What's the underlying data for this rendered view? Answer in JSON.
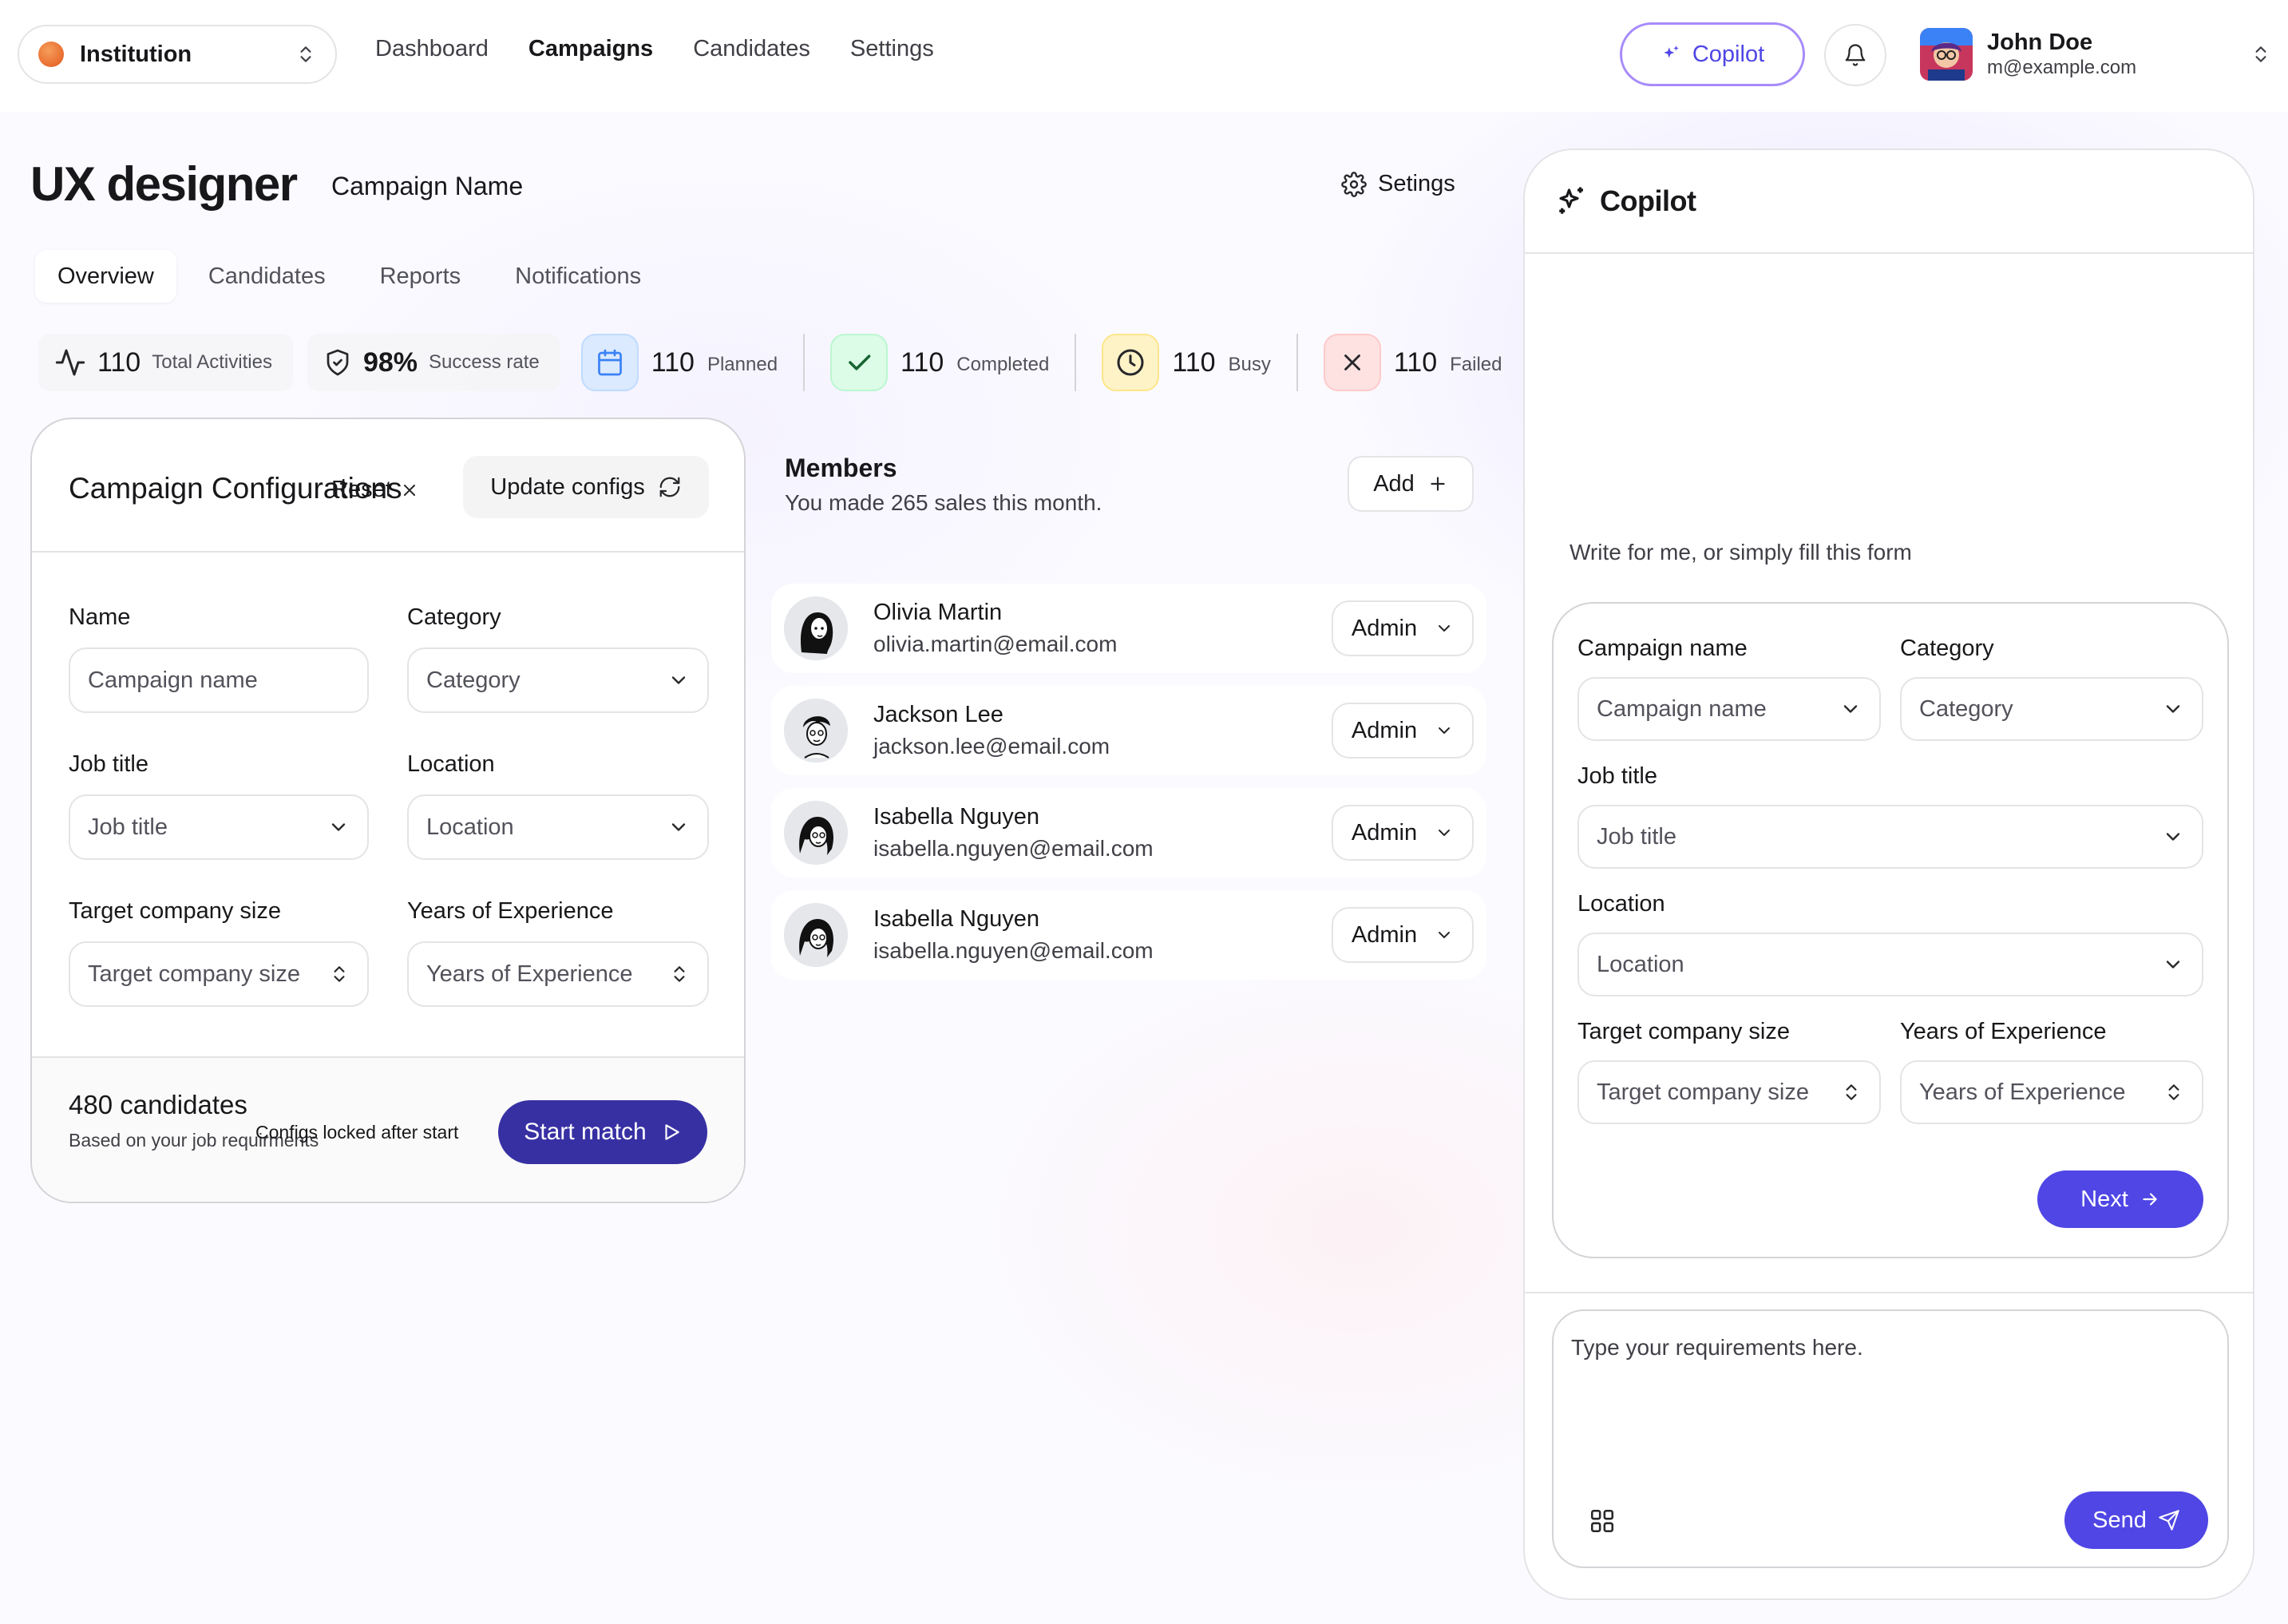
{
  "topbar": {
    "institution": "Institution",
    "nav": [
      "Dashboard",
      "Campaigns",
      "Candidates",
      "Settings"
    ],
    "active_nav": "Campaigns",
    "copilot_label": "Copilot",
    "user": {
      "name": "John Doe",
      "email": "m@example.com"
    }
  },
  "header": {
    "title": "UX designer",
    "campaign_name": "Campaign Name",
    "settings_label": "Setings"
  },
  "tabs": [
    "Overview",
    "Candidates",
    "Reports",
    "Notifications"
  ],
  "active_tab": "Overview",
  "stats": {
    "total": {
      "value": "110",
      "label": "Total Activities"
    },
    "success": {
      "value": "98%",
      "label": "Success rate"
    },
    "planned": {
      "value": "110",
      "label": "Planned",
      "color": "#dbeafe"
    },
    "completed": {
      "value": "110",
      "label": "Completed",
      "color": "#dcfce7"
    },
    "busy": {
      "value": "110",
      "label": "Busy",
      "color": "#fef3c7"
    },
    "failed": {
      "value": "110",
      "label": "Failed",
      "color": "#fee2e2"
    }
  },
  "config": {
    "title": "Campaign Configurations",
    "reset_label": "Reset",
    "update_label": "Update configs",
    "fields": {
      "name": {
        "label": "Name",
        "placeholder": "Campaign name"
      },
      "category": {
        "label": "Category",
        "placeholder": "Category"
      },
      "job_title": {
        "label": "Job title",
        "placeholder": "Job title"
      },
      "location": {
        "label": "Location",
        "placeholder": "Location"
      },
      "company_size": {
        "label": "Target company size",
        "placeholder": "Target company size"
      },
      "experience": {
        "label": "Years of Experience",
        "placeholder": "Years of Experience"
      }
    },
    "candidates": "480 candidates",
    "candidates_sub": "Based on your job requirments",
    "locked": "Configs locked after start",
    "start_label": "Start match"
  },
  "members": {
    "title": "Members",
    "subtitle": "You made 265 sales this month.",
    "add_label": "Add",
    "list": [
      {
        "name": "Olivia Martin",
        "email": "olivia.martin@email.com",
        "role": "Admin"
      },
      {
        "name": "Jackson Lee",
        "email": "jackson.lee@email.com",
        "role": "Admin"
      },
      {
        "name": "Isabella Nguyen",
        "email": "isabella.nguyen@email.com",
        "role": "Admin"
      },
      {
        "name": "Isabella Nguyen",
        "email": "isabella.nguyen@email.com",
        "role": "Admin"
      }
    ]
  },
  "copilot": {
    "title": "Copilot",
    "prompt": "Write for me, or simply fill this form",
    "fields": {
      "campaign_name": {
        "label": "Campaign name",
        "placeholder": "Campaign name"
      },
      "category": {
        "label": "Category",
        "placeholder": "Category"
      },
      "job_title": {
        "label": "Job title",
        "placeholder": "Job title"
      },
      "location": {
        "label": "Location",
        "placeholder": "Location"
      },
      "company_size": {
        "label": "Target company size",
        "placeholder": "Target company size"
      },
      "experience": {
        "label": "Years of Experience",
        "placeholder": "Years of Experience"
      }
    },
    "next_label": "Next",
    "input_placeholder": "Type your requirements here.",
    "send_label": "Send"
  },
  "colors": {
    "primary": "#4f46e5",
    "primary_dark": "#3730a3",
    "copilot_border": "#a78bfa"
  }
}
